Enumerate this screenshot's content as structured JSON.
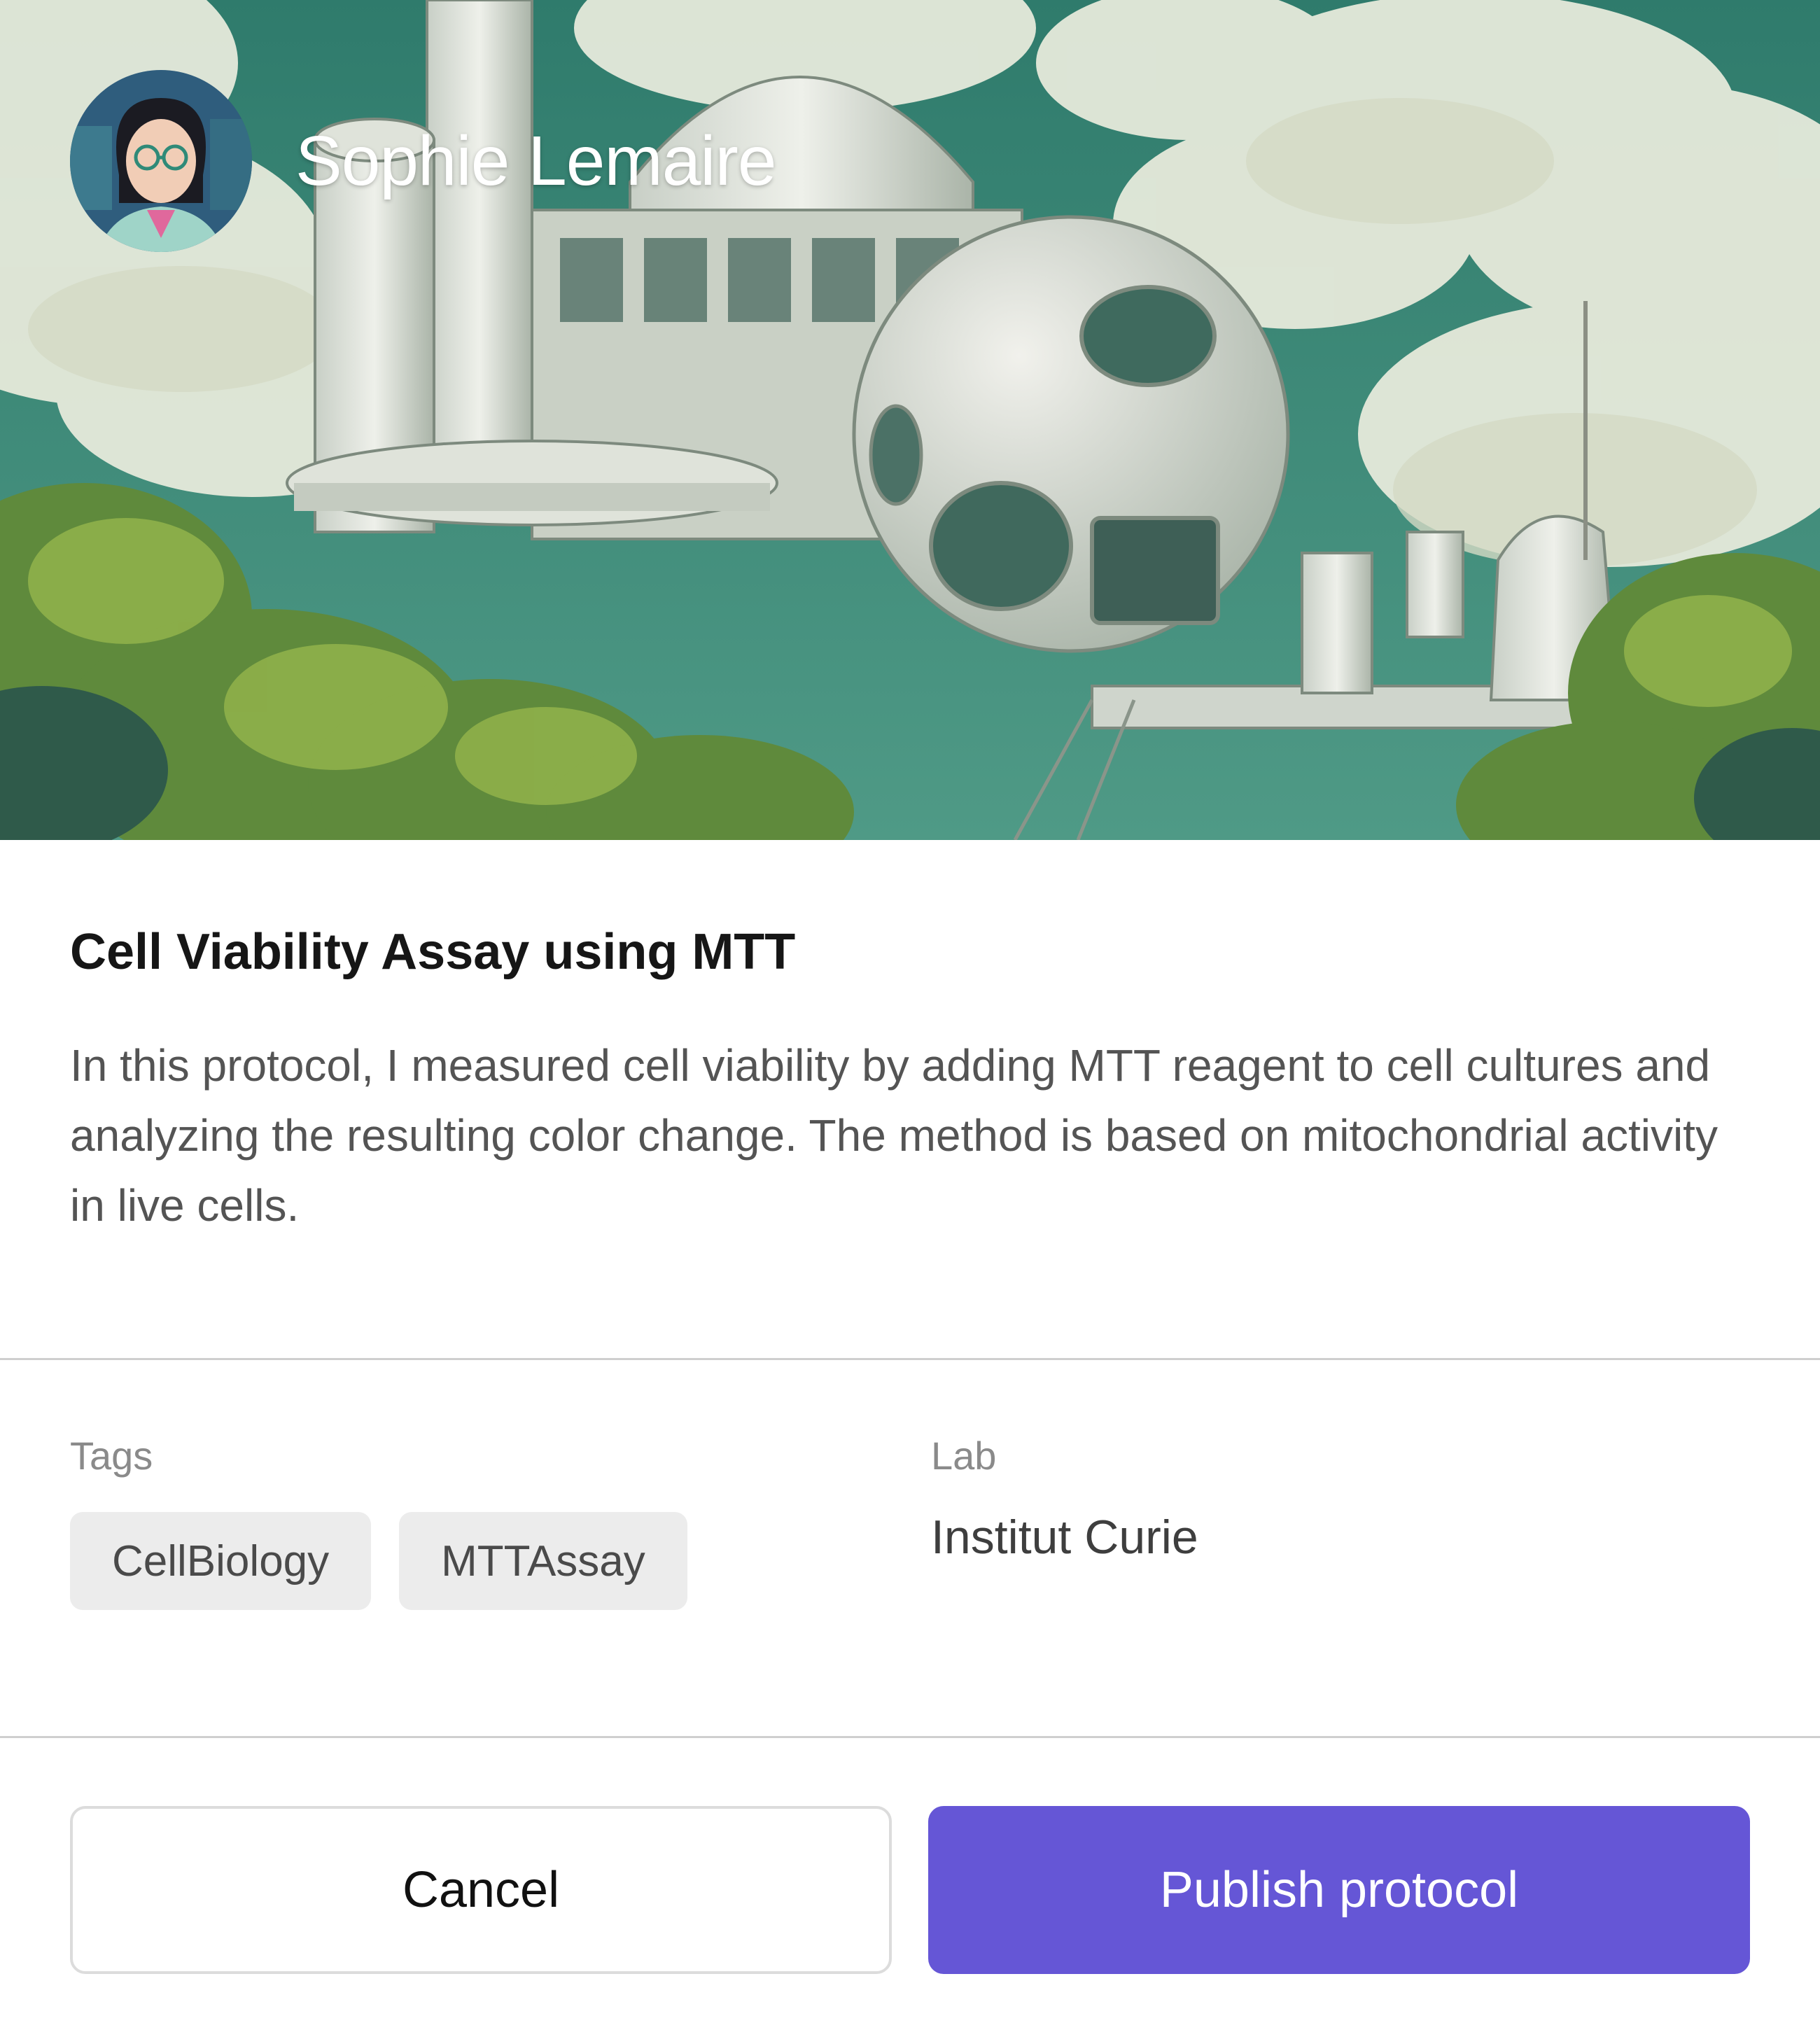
{
  "hero": {
    "image_description_icon": "futuristic-lab-building-illustration-icon",
    "author": {
      "avatar_icon": "scientist-avatar-icon",
      "name": "Sophie Lemaire"
    }
  },
  "protocol": {
    "title": "Cell Viability Assay using MTT",
    "description": "In this protocol, I measured cell viability by adding MTT reagent to cell cultures and analyzing the resulting color change. The method is based on mitochondrial activity in live cells."
  },
  "meta": {
    "tags_label": "Tags",
    "tags": [
      "CellBiology",
      "MTTAssay"
    ],
    "lab_label": "Lab",
    "lab_value": "Institut Curie"
  },
  "actions": {
    "cancel_label": "Cancel",
    "publish_label": "Publish protocol"
  },
  "colors": {
    "accent": "#6556d6",
    "tag_bg": "#ececec",
    "divider": "#cfcfcf",
    "hero_sky": "#3f8a78"
  }
}
